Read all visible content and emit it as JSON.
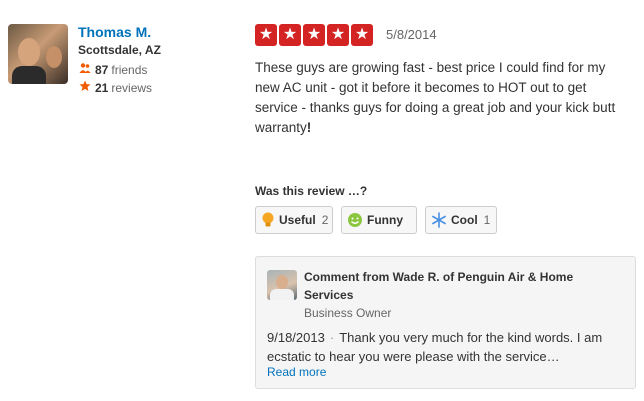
{
  "user": {
    "name": "Thomas M.",
    "location": "Scottsdale, AZ",
    "friends_count": "87",
    "friends_label": "friends",
    "reviews_count": "21",
    "reviews_label": "reviews",
    "friends_icon": "friends-icon",
    "reviews_icon": "star-icon"
  },
  "review": {
    "rating": 5,
    "star_glyph": "★",
    "date": "5/8/2014",
    "text": "These guys are growing fast - best price I could find for my new AC unit - got it before it becomes to HOT out to get service - thanks guys for doing a great job and your kick butt warranty",
    "text_end": "!"
  },
  "votes": {
    "title": "Was this review …?",
    "useful_label": "Useful",
    "useful_count": "2",
    "funny_label": "Funny",
    "cool_label": "Cool",
    "cool_count": "1"
  },
  "comment": {
    "title": "Comment from Wade R. of Penguin Air & Home Services",
    "role": "Business Owner",
    "date": "9/18/2013",
    "separator": "·",
    "text": "Thank you very much for the kind words.  I am ecstatic to hear you were please with the service…",
    "read_more": "Read more"
  },
  "colors": {
    "star_red": "#d32323",
    "link_blue": "#0073bb",
    "useful_icon": "#f5a623",
    "funny_icon": "#8cc63f",
    "cool_icon": "#4a90e2"
  }
}
